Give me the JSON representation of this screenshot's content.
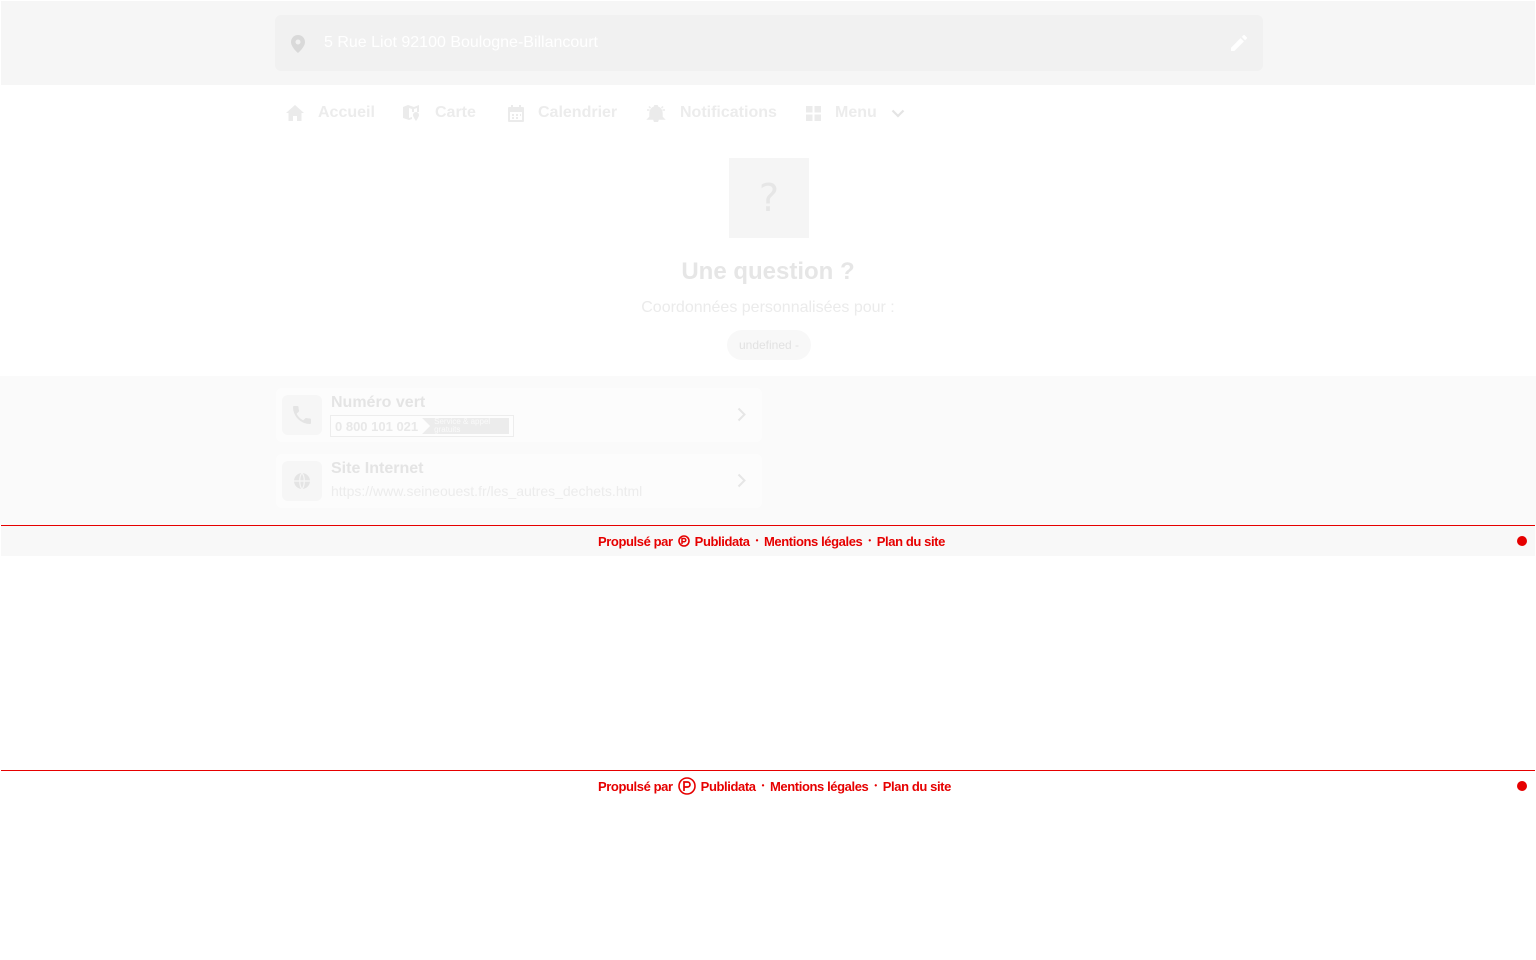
{
  "address": {
    "text": "5 Rue Liot 92100 Boulogne-Billancourt",
    "pin_icon": "location-pin-icon",
    "edit_icon": "pencil-icon"
  },
  "nav": {
    "items": [
      {
        "label": "Accueil",
        "icon": "home-icon"
      },
      {
        "label": "Carte",
        "icon": "map-icon"
      },
      {
        "label": "Calendrier",
        "icon": "calendar-icon"
      },
      {
        "label": "Notifications",
        "icon": "bell-icon"
      },
      {
        "label": "Menu",
        "icon": "grid-icon",
        "dropdown_icon": "chevron-down-icon"
      }
    ]
  },
  "question": {
    "icon_glyph": "?",
    "title": "Une question ?",
    "subtitle": "Coordonnées personnalisées pour :",
    "chip": "undefined -"
  },
  "contacts": {
    "phone": {
      "title": "Numéro vert",
      "number": "0 800 101 021",
      "tag": "Service & appel gratuits",
      "icon": "phone-icon"
    },
    "website": {
      "title": "Site Internet",
      "url": "https://www.seineouest.fr/les_autres_dechets.html",
      "icon": "globe-icon"
    }
  },
  "footer": {
    "powered_by": "Propulsé par",
    "brand": "Publidata",
    "legal": "Mentions légales",
    "sitemap": "Plan du site",
    "separator": "•"
  },
  "colors": {
    "accent": "#e60000",
    "muted_text": "#e6e6e6",
    "topbar_bg": "#f6f6f6"
  }
}
